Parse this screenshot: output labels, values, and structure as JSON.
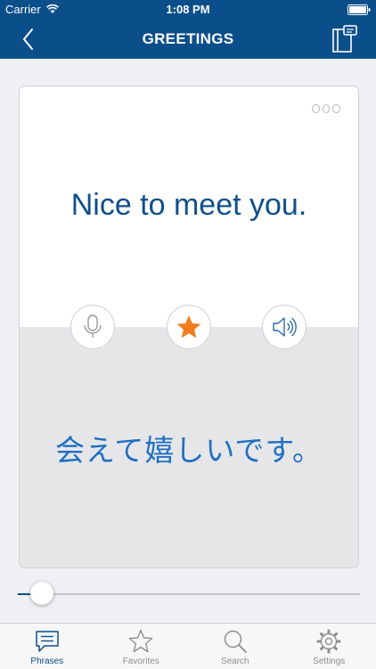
{
  "status_bar": {
    "carrier": "Carrier",
    "time": "1:08 PM"
  },
  "nav": {
    "title": "GREETINGS",
    "back_icon": "chevron-left-icon",
    "action_icon": "notebook-icon"
  },
  "card": {
    "english": "Nice to meet you.",
    "japanese": "会えて嬉しいです。",
    "favorite": true,
    "buttons": [
      "microphone-icon",
      "star-icon",
      "speaker-icon"
    ]
  },
  "slider": {
    "progress": 0.05
  },
  "tabs": [
    {
      "label": "Phrases",
      "icon": "speech-bubble-icon",
      "active": true
    },
    {
      "label": "Favorites",
      "icon": "star-outline-icon",
      "active": false
    },
    {
      "label": "Search",
      "icon": "magnifier-icon",
      "active": false
    },
    {
      "label": "Settings",
      "icon": "gear-icon",
      "active": false
    }
  ],
  "colors": {
    "brand": "#0b4f8a",
    "english_text": "#104f8a",
    "japanese_text": "#1f6fc3",
    "favorite_star": "#f07c1e"
  }
}
